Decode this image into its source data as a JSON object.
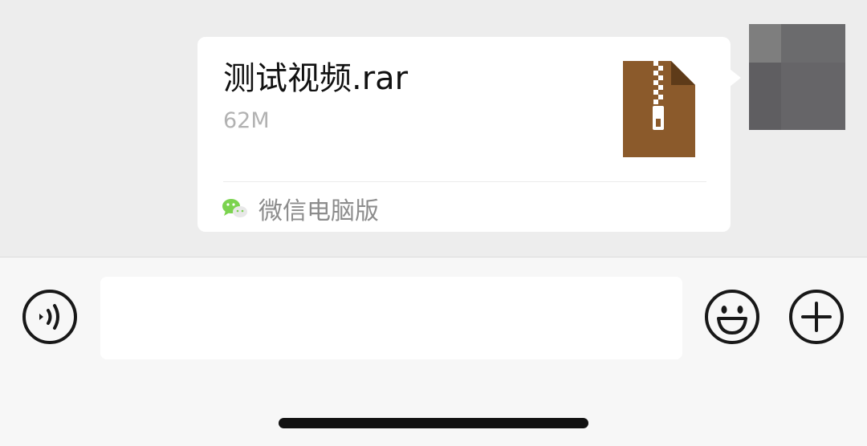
{
  "message": {
    "file_name": "测试视频.rar",
    "file_size": "62M",
    "file_icon": "zip-archive-icon",
    "source_icon": "wechat-icon",
    "source_label": "微信电脑版"
  },
  "avatar": {
    "description": "pixelated-avatar"
  },
  "input_bar": {
    "voice_icon": "voice-icon",
    "emoji_icon": "emoji-icon",
    "plus_icon": "plus-icon",
    "input_value": ""
  },
  "colors": {
    "chat_bg": "#ededed",
    "bubble_bg": "#ffffff",
    "archive_brown": "#8b5a2b",
    "wechat_green": "#7bd34f",
    "input_bar_bg": "#f7f7f7"
  }
}
